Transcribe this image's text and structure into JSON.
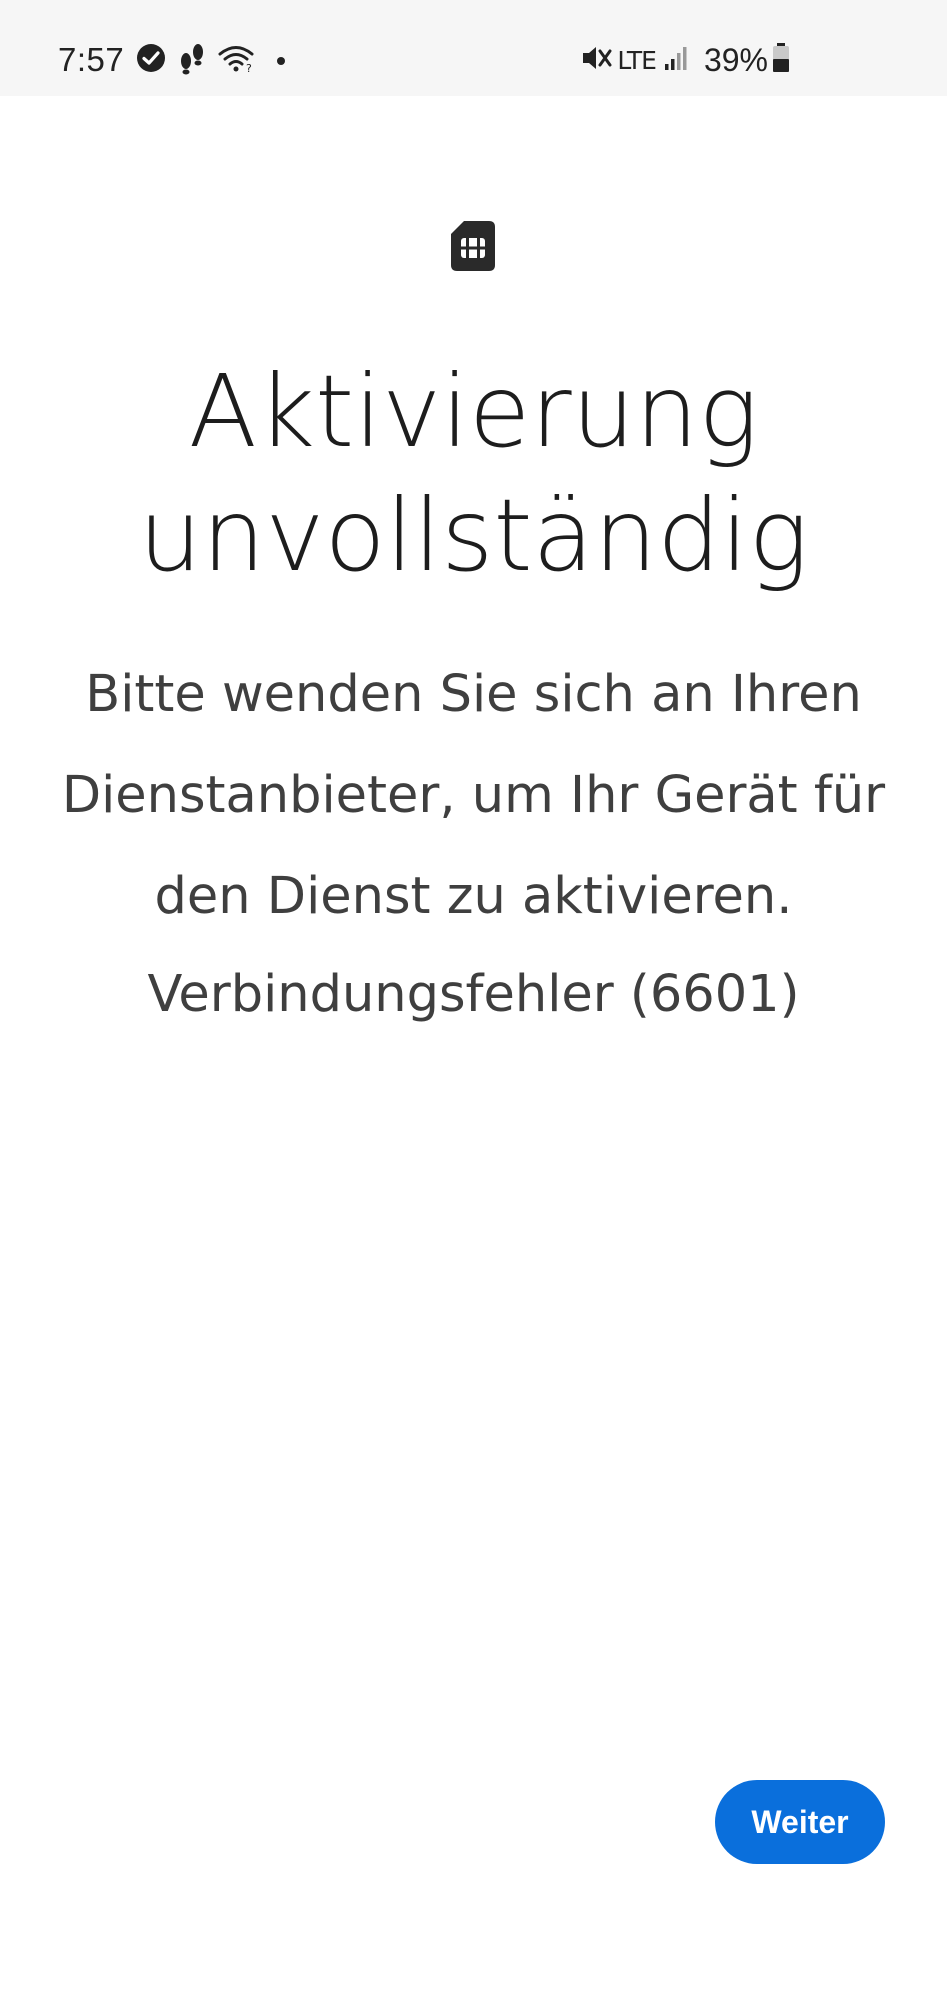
{
  "status_bar": {
    "time": "7:57",
    "network": "LTE",
    "battery": "39%",
    "icons": [
      "check-circle-icon",
      "steps-icon",
      "wifi-icon",
      "dot-icon",
      "mute-icon",
      "signal-icon",
      "battery-icon"
    ]
  },
  "page": {
    "icon": "sim-card-icon",
    "title_line1": "Aktivierung",
    "title_line2": "unvollständig",
    "body_line1": "Bitte wenden Sie sich an Ihren",
    "body_line2": "Dienstanbieter, um Ihr Gerät für",
    "body_line3": "den Dienst zu aktivieren.",
    "error_text": "Verbindungsfehler (6601)"
  },
  "actions": {
    "next_label": "Weiter"
  },
  "colors": {
    "accent": "#0a6fdc",
    "title": "#1d1d1d",
    "body": "#3f3f3f",
    "status_bar_bg": "#f6f6f6"
  }
}
